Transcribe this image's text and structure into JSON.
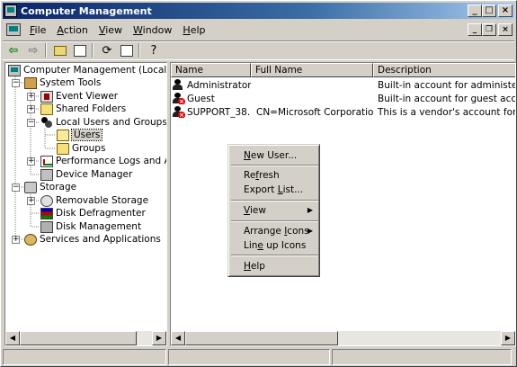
{
  "window": {
    "title": "Computer Management",
    "buttons": {
      "minimize": "_",
      "maximize": "□",
      "close": "×"
    }
  },
  "menubar": {
    "items": [
      {
        "label": "File",
        "accel": "F",
        "rest": "ile"
      },
      {
        "label": "Action",
        "accel": "A",
        "rest": "ction"
      },
      {
        "label": "View",
        "accel": "V",
        "rest": "iew"
      },
      {
        "label": "Window",
        "accel": "W",
        "rest": "indow"
      },
      {
        "label": "Help",
        "accel": "H",
        "rest": "elp"
      }
    ],
    "mdi_buttons": {
      "minimize": "_",
      "restore": "❐",
      "close": "×"
    }
  },
  "toolbar": {
    "icons": [
      "back-arrow-icon",
      "forward-arrow-icon",
      "up-folder-icon",
      "show-hide-tree-icon",
      "refresh-icon",
      "export-list-icon",
      "help-icon"
    ]
  },
  "tree": {
    "items": [
      {
        "label": "Computer Management (Local)",
        "icon": "computer-icon"
      },
      {
        "label": "System Tools",
        "icon": "system-tools-icon"
      },
      {
        "label": "Event Viewer",
        "icon": "event-viewer-icon"
      },
      {
        "label": "Shared Folders",
        "icon": "folder-icon"
      },
      {
        "label": "Local Users and Groups",
        "icon": "users-icon"
      },
      {
        "label": "Users",
        "icon": "folder-open-icon"
      },
      {
        "label": "Groups",
        "icon": "folder-icon"
      },
      {
        "label": "Performance Logs and Alerts",
        "icon": "performance-icon"
      },
      {
        "label": "Device Manager",
        "icon": "device-manager-icon"
      },
      {
        "label": "Storage",
        "icon": "storage-icon"
      },
      {
        "label": "Removable Storage",
        "icon": "removable-storage-icon"
      },
      {
        "label": "Disk Defragmenter",
        "icon": "defragmenter-icon"
      },
      {
        "label": "Disk Management",
        "icon": "disk-management-icon"
      },
      {
        "label": "Services and Applications",
        "icon": "services-icon"
      }
    ]
  },
  "list": {
    "columns": [
      "Name",
      "Full Name",
      "Description"
    ],
    "rows": [
      {
        "name": "Administrator",
        "full_name": "",
        "description": "Built-in account for administering th",
        "disabled": false
      },
      {
        "name": "Guest",
        "full_name": "",
        "description": "Built-in account for guest access to",
        "disabled": true
      },
      {
        "name": "SUPPORT_38...",
        "full_name": "CN=Microsoft Corporation...",
        "description": "This is a vendor's account for the H",
        "disabled": true
      }
    ]
  },
  "context_menu": {
    "items": [
      {
        "label": "New User...",
        "accel": "N",
        "rest": "ew User...",
        "submenu": false
      },
      {
        "label": "Refresh",
        "accel": "f",
        "pre": "Re",
        "rest": "resh",
        "submenu": false
      },
      {
        "label": "Export List...",
        "accel": "L",
        "pre": "Export ",
        "rest": "ist...",
        "submenu": false
      },
      {
        "label": "View",
        "accel": "V",
        "rest": "iew",
        "submenu": true
      },
      {
        "label": "Arrange Icons",
        "accel": "I",
        "pre": "Arrange ",
        "rest": "cons",
        "submenu": true
      },
      {
        "label": "Line up Icons",
        "accel": "e",
        "pre": "Lin",
        "rest": " up Icons",
        "submenu": false
      },
      {
        "label": "Help",
        "accel": "H",
        "rest": "elp",
        "submenu": false
      }
    ],
    "submenu_arrow": "▶"
  },
  "scroll": {
    "left": "◀",
    "right": "▶"
  },
  "colors": {
    "titlebar_start": "#0a246a",
    "titlebar_end": "#a6caf0",
    "face": "#d4d0c8",
    "disabled_badge": "#e00000"
  }
}
